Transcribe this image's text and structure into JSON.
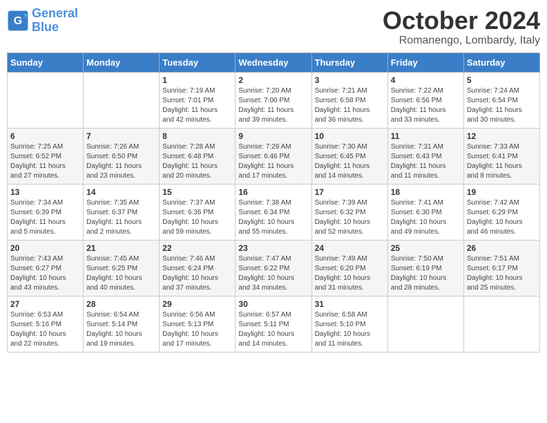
{
  "logo": {
    "line1": "General",
    "line2": "Blue"
  },
  "title": "October 2024",
  "location": "Romanengo, Lombardy, Italy",
  "days_of_week": [
    "Sunday",
    "Monday",
    "Tuesday",
    "Wednesday",
    "Thursday",
    "Friday",
    "Saturday"
  ],
  "weeks": [
    [
      {
        "day": "",
        "detail": ""
      },
      {
        "day": "",
        "detail": ""
      },
      {
        "day": "1",
        "detail": "Sunrise: 7:19 AM\nSunset: 7:01 PM\nDaylight: 11 hours\nand 42 minutes."
      },
      {
        "day": "2",
        "detail": "Sunrise: 7:20 AM\nSunset: 7:00 PM\nDaylight: 11 hours\nand 39 minutes."
      },
      {
        "day": "3",
        "detail": "Sunrise: 7:21 AM\nSunset: 6:58 PM\nDaylight: 11 hours\nand 36 minutes."
      },
      {
        "day": "4",
        "detail": "Sunrise: 7:22 AM\nSunset: 6:56 PM\nDaylight: 11 hours\nand 33 minutes."
      },
      {
        "day": "5",
        "detail": "Sunrise: 7:24 AM\nSunset: 6:54 PM\nDaylight: 11 hours\nand 30 minutes."
      }
    ],
    [
      {
        "day": "6",
        "detail": "Sunrise: 7:25 AM\nSunset: 6:52 PM\nDaylight: 11 hours\nand 27 minutes."
      },
      {
        "day": "7",
        "detail": "Sunrise: 7:26 AM\nSunset: 6:50 PM\nDaylight: 11 hours\nand 23 minutes."
      },
      {
        "day": "8",
        "detail": "Sunrise: 7:28 AM\nSunset: 6:48 PM\nDaylight: 11 hours\nand 20 minutes."
      },
      {
        "day": "9",
        "detail": "Sunrise: 7:29 AM\nSunset: 6:46 PM\nDaylight: 11 hours\nand 17 minutes."
      },
      {
        "day": "10",
        "detail": "Sunrise: 7:30 AM\nSunset: 6:45 PM\nDaylight: 11 hours\nand 14 minutes."
      },
      {
        "day": "11",
        "detail": "Sunrise: 7:31 AM\nSunset: 6:43 PM\nDaylight: 11 hours\nand 11 minutes."
      },
      {
        "day": "12",
        "detail": "Sunrise: 7:33 AM\nSunset: 6:41 PM\nDaylight: 11 hours\nand 8 minutes."
      }
    ],
    [
      {
        "day": "13",
        "detail": "Sunrise: 7:34 AM\nSunset: 6:39 PM\nDaylight: 11 hours\nand 5 minutes."
      },
      {
        "day": "14",
        "detail": "Sunrise: 7:35 AM\nSunset: 6:37 PM\nDaylight: 11 hours\nand 2 minutes."
      },
      {
        "day": "15",
        "detail": "Sunrise: 7:37 AM\nSunset: 6:36 PM\nDaylight: 10 hours\nand 59 minutes."
      },
      {
        "day": "16",
        "detail": "Sunrise: 7:38 AM\nSunset: 6:34 PM\nDaylight: 10 hours\nand 55 minutes."
      },
      {
        "day": "17",
        "detail": "Sunrise: 7:39 AM\nSunset: 6:32 PM\nDaylight: 10 hours\nand 52 minutes."
      },
      {
        "day": "18",
        "detail": "Sunrise: 7:41 AM\nSunset: 6:30 PM\nDaylight: 10 hours\nand 49 minutes."
      },
      {
        "day": "19",
        "detail": "Sunrise: 7:42 AM\nSunset: 6:29 PM\nDaylight: 10 hours\nand 46 minutes."
      }
    ],
    [
      {
        "day": "20",
        "detail": "Sunrise: 7:43 AM\nSunset: 6:27 PM\nDaylight: 10 hours\nand 43 minutes."
      },
      {
        "day": "21",
        "detail": "Sunrise: 7:45 AM\nSunset: 6:25 PM\nDaylight: 10 hours\nand 40 minutes."
      },
      {
        "day": "22",
        "detail": "Sunrise: 7:46 AM\nSunset: 6:24 PM\nDaylight: 10 hours\nand 37 minutes."
      },
      {
        "day": "23",
        "detail": "Sunrise: 7:47 AM\nSunset: 6:22 PM\nDaylight: 10 hours\nand 34 minutes."
      },
      {
        "day": "24",
        "detail": "Sunrise: 7:49 AM\nSunset: 6:20 PM\nDaylight: 10 hours\nand 31 minutes."
      },
      {
        "day": "25",
        "detail": "Sunrise: 7:50 AM\nSunset: 6:19 PM\nDaylight: 10 hours\nand 28 minutes."
      },
      {
        "day": "26",
        "detail": "Sunrise: 7:51 AM\nSunset: 6:17 PM\nDaylight: 10 hours\nand 25 minutes."
      }
    ],
    [
      {
        "day": "27",
        "detail": "Sunrise: 6:53 AM\nSunset: 5:16 PM\nDaylight: 10 hours\nand 22 minutes."
      },
      {
        "day": "28",
        "detail": "Sunrise: 6:54 AM\nSunset: 5:14 PM\nDaylight: 10 hours\nand 19 minutes."
      },
      {
        "day": "29",
        "detail": "Sunrise: 6:56 AM\nSunset: 5:13 PM\nDaylight: 10 hours\nand 17 minutes."
      },
      {
        "day": "30",
        "detail": "Sunrise: 6:57 AM\nSunset: 5:11 PM\nDaylight: 10 hours\nand 14 minutes."
      },
      {
        "day": "31",
        "detail": "Sunrise: 6:58 AM\nSunset: 5:10 PM\nDaylight: 10 hours\nand 11 minutes."
      },
      {
        "day": "",
        "detail": ""
      },
      {
        "day": "",
        "detail": ""
      }
    ]
  ]
}
